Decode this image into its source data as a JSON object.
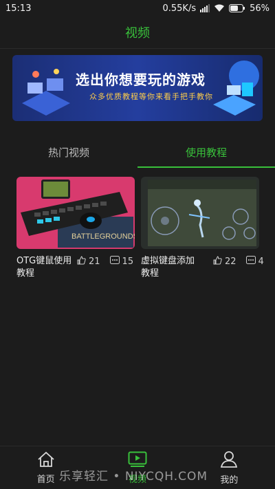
{
  "status": {
    "time": "15:13",
    "speed": "0.55K/s",
    "battery": "56%"
  },
  "header": {
    "title": "视频"
  },
  "banner": {
    "headline": "选出你想要玩的游戏",
    "subline": "众多优质教程等你来看手把手教你"
  },
  "tabs": [
    {
      "label": "热门视频",
      "active": false
    },
    {
      "label": "使用教程",
      "active": true
    }
  ],
  "videos": [
    {
      "title": "OTG键鼠使用教程",
      "likes": "21",
      "comments": "15"
    },
    {
      "title": "虚拟键盘添加教程",
      "likes": "22",
      "comments": "4"
    }
  ],
  "nav": [
    {
      "label": "首页"
    },
    {
      "label": "视频"
    },
    {
      "label": "我的"
    }
  ],
  "watermark": "乐享轻汇 • NIYCQH.COM",
  "colors": {
    "accent": "#39c13b",
    "background": "#1c1c1c"
  },
  "icons": [
    "signal-icon",
    "wifi-icon",
    "battery-icon",
    "like-icon",
    "comment-icon",
    "home-icon",
    "video-icon",
    "profile-icon"
  ]
}
